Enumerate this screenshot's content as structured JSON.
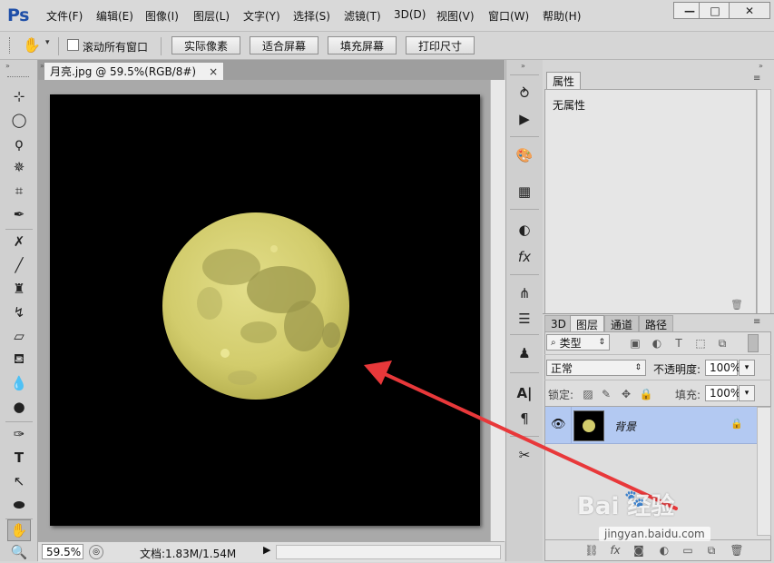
{
  "app": {
    "logo": "Ps",
    "menus": [
      "文件(F)",
      "编辑(E)",
      "图像(I)",
      "图层(L)",
      "文字(Y)",
      "选择(S)",
      "滤镜(T)",
      "3D(D)",
      "视图(V)",
      "窗口(W)",
      "帮助(H)"
    ],
    "window_controls": [
      "—",
      "□",
      "✕"
    ]
  },
  "options_bar": {
    "scroll_all_label": "滚动所有窗口",
    "buttons": [
      "实际像素",
      "适合屏幕",
      "填充屏幕",
      "打印尺寸"
    ]
  },
  "document": {
    "tab_title": "月亮.jpg @ 59.5%(RGB/8#)",
    "tab_close": "×",
    "zoom": "59.5%",
    "doc_info": "文档:1.83M/1.54M"
  },
  "properties_panel": {
    "tab": "属性",
    "content": "无属性"
  },
  "layers_panel": {
    "tabs": [
      "3D",
      "图层",
      "通道",
      "路径"
    ],
    "active_tab": "图层",
    "filter_label": "类型",
    "blend_mode": "正常",
    "opacity_label": "不透明度:",
    "opacity_value": "100%",
    "lock_label": "锁定:",
    "fill_label": "填充:",
    "fill_value": "100%",
    "layers": [
      {
        "name": "背景",
        "visible": true,
        "locked": true,
        "selected": true
      }
    ]
  },
  "watermark": {
    "brand": "Bai 经验",
    "url": "jingyan.baidu.com"
  },
  "colors": {
    "selected_layer": "#b3c9f2",
    "arrow": "#e8383a",
    "moon": "#d8d37a"
  }
}
